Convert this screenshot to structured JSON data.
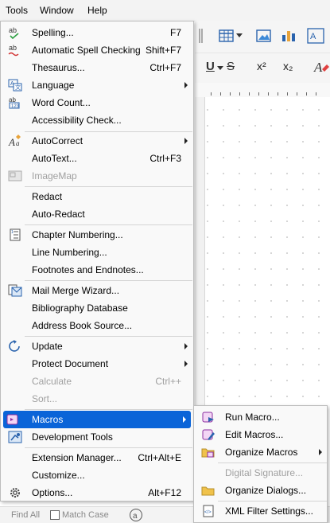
{
  "menubar": {
    "tools": "Tools",
    "window": "Window",
    "help": "Help"
  },
  "tools_menu": {
    "spelling": {
      "label": "Spelling...",
      "shortcut": "F7"
    },
    "auto_spell": {
      "label": "Automatic Spell Checking",
      "shortcut": "Shift+F7"
    },
    "thesaurus": {
      "label": "Thesaurus...",
      "shortcut": "Ctrl+F7"
    },
    "language": {
      "label": "Language"
    },
    "word_count": {
      "label": "Word Count..."
    },
    "accessibility": {
      "label": "Accessibility Check..."
    },
    "autocorrect": {
      "label": "AutoCorrect"
    },
    "autotext": {
      "label": "AutoText...",
      "shortcut": "Ctrl+F3"
    },
    "imagemap": {
      "label": "ImageMap"
    },
    "redact": {
      "label": "Redact"
    },
    "auto_redact": {
      "label": "Auto-Redact"
    },
    "chapter_numbering": {
      "label": "Chapter Numbering..."
    },
    "line_numbering": {
      "label": "Line Numbering..."
    },
    "footnotes": {
      "label": "Footnotes and Endnotes..."
    },
    "mail_merge": {
      "label": "Mail Merge Wizard..."
    },
    "bibliography": {
      "label": "Bibliography Database"
    },
    "address_book": {
      "label": "Address Book Source..."
    },
    "update": {
      "label": "Update"
    },
    "protect_document": {
      "label": "Protect Document"
    },
    "calculate": {
      "label": "Calculate",
      "shortcut": "Ctrl++"
    },
    "sort": {
      "label": "Sort..."
    },
    "macros": {
      "label": "Macros"
    },
    "dev_tools": {
      "label": "Development Tools"
    },
    "extension_manager": {
      "label": "Extension Manager...",
      "shortcut": "Ctrl+Alt+E"
    },
    "customize": {
      "label": "Customize..."
    },
    "options": {
      "label": "Options...",
      "shortcut": "Alt+F12"
    }
  },
  "macros_submenu": {
    "run_macro": {
      "label": "Run Macro..."
    },
    "edit_macros": {
      "label": "Edit Macros..."
    },
    "organize_macros": {
      "label": "Organize Macros"
    },
    "digital_signature": {
      "label": "Digital Signature..."
    },
    "organize_dialogs": {
      "label": "Organize Dialogs..."
    },
    "xml_filter": {
      "label": "XML Filter Settings..."
    }
  },
  "findbar": {
    "find_all": "Find All",
    "match_case": "Match Case"
  },
  "formatting": {
    "superscript": "x²",
    "subscript": "x₂",
    "strike": "S",
    "underline": "U"
  },
  "colors": {
    "selection": "#0a64d8",
    "disabled_text": "#a0a0a0",
    "menu_bg": "#f9f9f9"
  }
}
